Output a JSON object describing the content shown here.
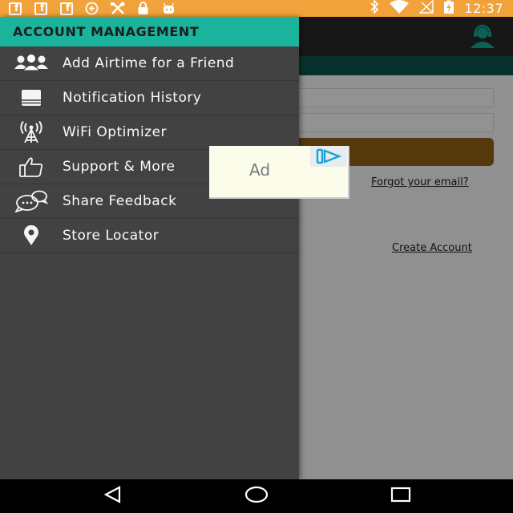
{
  "status_bar": {
    "time": "12:37",
    "fb_glyph": "f",
    "notification_icons": [
      "facebook-icon",
      "facebook-icon",
      "facebook-icon",
      "data-saver-icon",
      "tools-icon",
      "lock-icon",
      "android-icon"
    ],
    "system_icons": [
      "bluetooth-icon",
      "wifi-icon",
      "no-signal-icon",
      "battery-charging-icon"
    ]
  },
  "drawer": {
    "title": "ACCOUNT MANAGEMENT",
    "items": [
      {
        "label": "Add Airtime for a Friend",
        "icon": "group-icon"
      },
      {
        "label": "Notification History",
        "icon": "notification-history-icon"
      },
      {
        "label": "WiFi Optimizer",
        "icon": "wifi-tower-icon"
      },
      {
        "label": "Support & More",
        "icon": "thumbs-up-icon"
      },
      {
        "label": "Share Feedback",
        "icon": "feedback-chat-icon"
      },
      {
        "label": "Store Locator",
        "icon": "location-pin-icon"
      }
    ]
  },
  "background": {
    "forgot_email_link": "Forgot your email?",
    "create_account_link": "Create Account"
  },
  "ad": {
    "label": "Ad",
    "badge_icon": "adchoices-icon"
  },
  "nav_bar": {
    "buttons": [
      "back-icon",
      "home-icon",
      "recents-icon"
    ]
  },
  "colors": {
    "status_bar": "#f2a23a",
    "drawer_header": "#1ab39b",
    "drawer_background": "#424242",
    "app_header": "#262626",
    "app_teal_band": "#0c4f48",
    "login_button": "#8a5b12",
    "ad_background": "#fbfce9",
    "ad_badge_accent": "#1aa3d9"
  }
}
